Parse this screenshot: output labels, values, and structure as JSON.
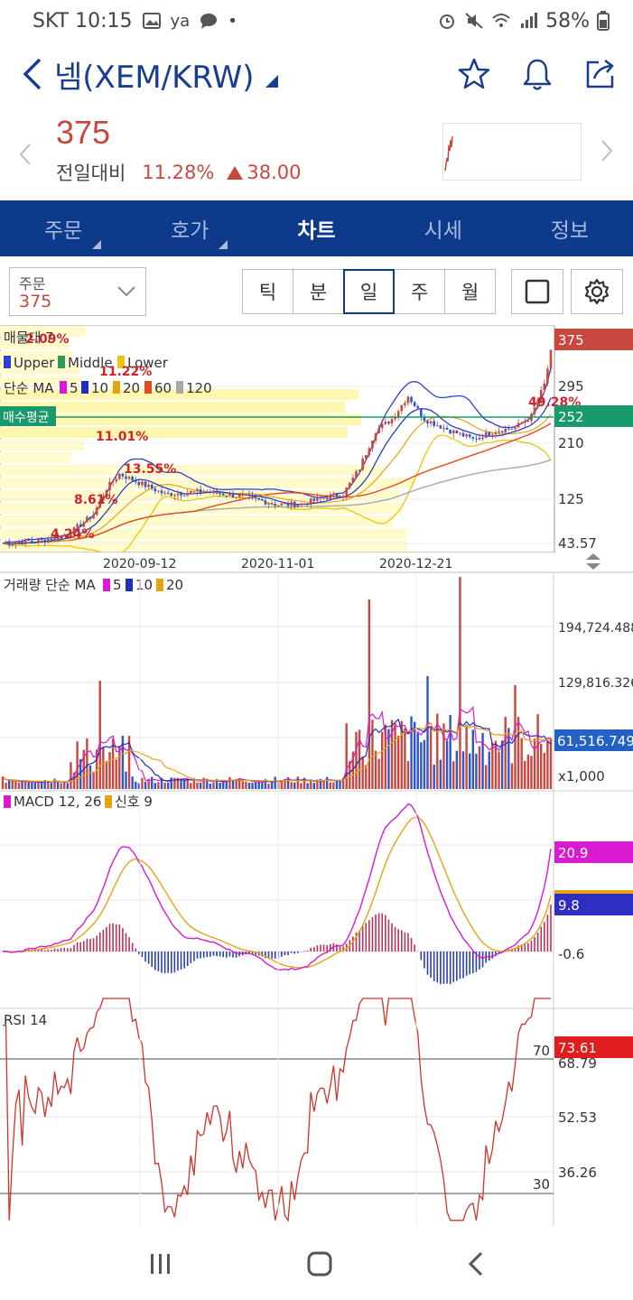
{
  "status_bar": {
    "carrier_time": "SKT 10:15",
    "extra_text": "ya",
    "battery": "58%",
    "icons": [
      "image-icon",
      "chat-icon",
      "alarm-icon",
      "mute-icon",
      "wifi-icon",
      "signal-icon",
      "battery-icon"
    ]
  },
  "header": {
    "title": "넴(XEM/KRW)",
    "icons": [
      "favorite-star-icon",
      "alert-bell-icon",
      "share-icon"
    ]
  },
  "quote": {
    "price": "375",
    "change_label": "전일대비",
    "change_pct": "11.28%",
    "change_abs": "38.00"
  },
  "tabs": [
    {
      "label": "주문",
      "active": false,
      "has_corner": true
    },
    {
      "label": "호가",
      "active": false,
      "has_corner": true
    },
    {
      "label": "차트",
      "active": true,
      "has_corner": false
    },
    {
      "label": "시세",
      "active": false,
      "has_corner": false
    },
    {
      "label": "정보",
      "active": false,
      "has_corner": false
    }
  ],
  "toolbar": {
    "order_label": "주문",
    "order_value": "375",
    "periods": [
      "틱",
      "분",
      "일",
      "주",
      "월"
    ],
    "active_period": "일"
  },
  "chart": {
    "price_panel": {
      "title_partial": "매물대 7",
      "bollinger_legend": [
        "Upper",
        "Middle",
        "Lower"
      ],
      "ma_legend_prefix": "단순 MA",
      "ma_legend": [
        "5",
        "10",
        "20",
        "60",
        "120"
      ],
      "avg_buy_label": "매수평균",
      "price_badge": "375",
      "avg_badge": "252",
      "axis_labels": [
        "295",
        "210",
        "125",
        "43.57"
      ],
      "annotations": [
        "2.09%",
        "11.22%",
        "11.01%",
        "13.55%",
        "8.61%",
        "4.24%",
        "49.28%"
      ],
      "dates": [
        "2020-09-12",
        "2020-11-01",
        "2020-12-21"
      ]
    },
    "volume_panel": {
      "title": "거래량 단순 MA",
      "ma_legend": [
        "5",
        "10",
        "20"
      ],
      "axis_labels": [
        "194,724.488",
        "129,816.326",
        "x1,000"
      ],
      "badge": "61,516.749"
    },
    "macd_panel": {
      "title": "MACD 12, 26",
      "signal_label": "신호 9",
      "badge_macd": "20.9",
      "badge_signal": "9.8",
      "axis_labels": [
        "-0.6"
      ]
    },
    "rsi_panel": {
      "title": "RSI 14",
      "badge": "73.61",
      "axis_labels": [
        "68.79",
        "52.53",
        "36.26"
      ],
      "level_labels": [
        "70",
        "30"
      ]
    },
    "colors": {
      "up": "#c8473f",
      "down": "#2f55c9",
      "ma5": "#d81bd0",
      "ma10": "#1e2fc2",
      "ma20": "#e8a313",
      "ma60": "#e34b1c",
      "ma120": "#a8a8a8",
      "avg_buy": "#1a9a6a"
    }
  },
  "navbar": {
    "icons": [
      "recent-apps-icon",
      "home-icon",
      "back-nav-icon"
    ]
  }
}
